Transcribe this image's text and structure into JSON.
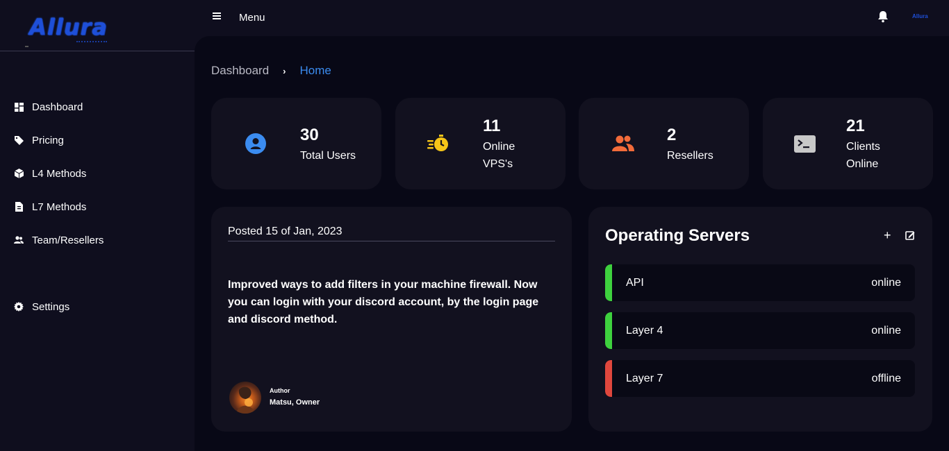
{
  "brand": {
    "logo_text": "Allura",
    "logo_small": "Allura"
  },
  "topbar": {
    "menu_label": "Menu"
  },
  "sidebar": {
    "items": [
      {
        "label": "Dashboard",
        "icon": "dashboard-icon"
      },
      {
        "label": "Pricing",
        "icon": "tag-icon"
      },
      {
        "label": "L4 Methods",
        "icon": "cube-icon"
      },
      {
        "label": "L7 Methods",
        "icon": "file-icon"
      },
      {
        "label": "Team/Resellers",
        "icon": "users-icon"
      },
      {
        "label": "Settings",
        "icon": "gear-icon"
      }
    ]
  },
  "breadcrumb": {
    "parent": "Dashboard",
    "separator": "›",
    "current": "Home"
  },
  "stats": [
    {
      "value": "30",
      "label_line1": "Total Users",
      "label_line2": "",
      "icon": "user-circle-icon",
      "color": "#3b8cf0"
    },
    {
      "value": "11",
      "label_line1": "Online",
      "label_line2": "VPS's",
      "icon": "stopwatch-icon",
      "color": "#f5c518"
    },
    {
      "value": "2",
      "label_line1": "Resellers",
      "label_line2": "",
      "icon": "users-icon",
      "color": "#f26b3a"
    },
    {
      "value": "21",
      "label_line1": "Clients",
      "label_line2": "Online",
      "icon": "terminal-icon",
      "color": "#c8c8c8"
    }
  ],
  "post": {
    "date": "Posted 15 of Jan, 2023",
    "body": "Improved ways to add filters in your machine firewall. Now you can login with your discord account, by the login page and discord method.",
    "author_role": "Author",
    "author_name": "Matsu, Owner"
  },
  "servers": {
    "title": "Operating Servers",
    "add_label": "+",
    "rows": [
      {
        "name": "API",
        "status": "online",
        "color": "#3ed13e"
      },
      {
        "name": "Layer 4",
        "status": "online",
        "color": "#3ed13e"
      },
      {
        "name": "Layer 7",
        "status": "offline",
        "color": "#e0473d"
      }
    ]
  },
  "colors": {
    "accent": "#3b8cf0",
    "sidebar_bg": "#0f0e1e",
    "main_bg": "#080816",
    "card_bg": "#12111f"
  }
}
